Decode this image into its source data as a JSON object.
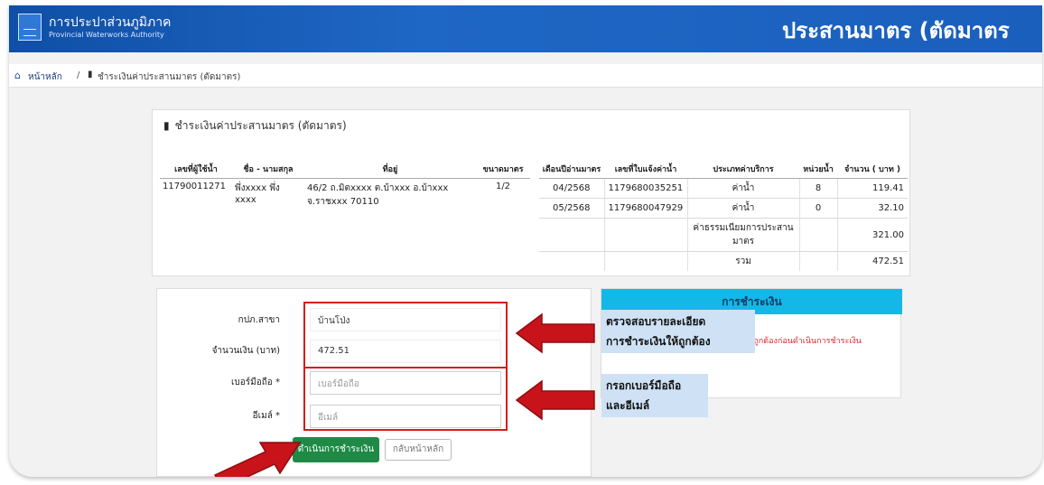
{
  "header": {
    "org_name_th": "การประปาส่วนภูมิภาค",
    "org_name_en": "Provincial Waterworks Authority",
    "page_title": "ประสานมาตร (ตัดมาตร"
  },
  "breadcrumb": {
    "home": "หน้าหลัก",
    "separator": "/",
    "current": "ชำระเงินค่าประสานมาตร (ตัดมาตร)"
  },
  "bill": {
    "title": "ชำระเงินค่าประสานมาตร (ตัดมาตร)",
    "user_table": {
      "headers": [
        "เลขที่ผู้ใช้น้ำ",
        "ชื่อ - นามสกุล",
        "ที่อยู่",
        "ขนาดมาตร"
      ],
      "row": [
        "11790011271",
        "พึ่งxxxx พึ่ง xxxx",
        "46/2 ถ.มิตxxxx ต.บ้าxxx อ.บ้าxxx จ.ราชxxx 70110",
        "1/2"
      ]
    },
    "charge_table": {
      "headers": [
        "เดือนปีอ่านมาตร",
        "เลขที่ใบแจ้งค่าน้ำ",
        "ประเภทค่าบริการ",
        "หน่วยน้ำ",
        "จำนวน ( บาท )"
      ],
      "rows": [
        [
          "04/2568",
          "1179680035251",
          "ค่าน้ำ",
          "8",
          "119.41"
        ],
        [
          "05/2568",
          "1179680047929",
          "ค่าน้ำ",
          "0",
          "32.10"
        ],
        [
          "",
          "",
          "ค่าธรรมเนียมการประสานมาตร",
          "",
          "321.00"
        ],
        [
          "",
          "",
          "รวม",
          "",
          "472.51"
        ]
      ]
    }
  },
  "form": {
    "branch_label": "กปภ.สาขา",
    "branch_value": "บ้านโป่ง",
    "amount_label": "จำนวนเงิน (บาท)",
    "amount_value": "472.51",
    "phone_label": "เบอร์มือถือ *",
    "phone_placeholder": "เบอร์มือถือ",
    "email_label": "อีเมล์ *",
    "email_placeholder": "อีเมล์",
    "pay_button": "ดำเนินการชำระเงิน",
    "home_button": "กลับหน้าหลัก"
  },
  "payment": {
    "title": "การชำระเงิน",
    "note": "ให้ถูกต้องก่อนดำเนินการชำระเงิน"
  },
  "callouts": {
    "verify_line1": "ตรวจสอบรายละเอียด",
    "verify_line2": "การชำระเงินให้ถูกต้อง",
    "contact_line1": "กรอกเบอร์มือถือ",
    "contact_line2": "และอีเมล์"
  },
  "colors": {
    "header_blue": "#1b5fbd",
    "pay_green": "#1e8a46",
    "pay_header_cyan": "#14b8e6",
    "annotation_red": "#d61c1c",
    "callout_bg": "#cfe2f5"
  }
}
